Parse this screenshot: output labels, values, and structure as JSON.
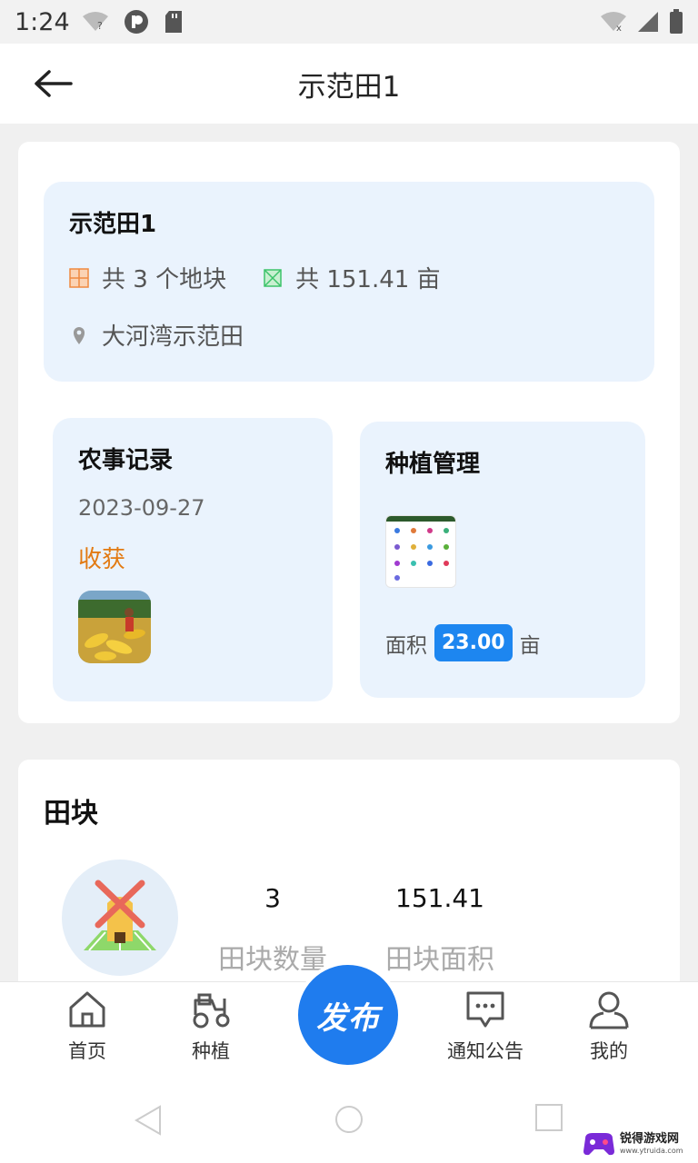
{
  "status_bar": {
    "time": "1:24"
  },
  "header": {
    "title": "示范田1"
  },
  "field_info": {
    "name": "示范田1",
    "plot_count_text": "共 3 个地块",
    "area_text": "共 151.41  亩",
    "location": "大河湾示范田"
  },
  "farm_record": {
    "title": "农事记录",
    "date": "2023-09-27",
    "type": "收获"
  },
  "plant_management": {
    "title": "种植管理",
    "area_label": "面积",
    "area_value": "23.00",
    "area_unit": "亩"
  },
  "field_blocks": {
    "title": "田块",
    "count_value": "3",
    "count_label": "田块数量",
    "area_value": "151.41",
    "area_label": "田块面积"
  },
  "bottom_nav": {
    "home": "首页",
    "plant": "种植",
    "publish": "发布",
    "notice": "通知公告",
    "mine": "我的"
  },
  "watermark": {
    "text": "锐得游戏网",
    "url": "www.ytruida.com"
  },
  "colors": {
    "accent": "#1f7cee",
    "badge": "#1d86f0",
    "harvest": "#e27a12",
    "card_bg": "#eaf3fd"
  }
}
